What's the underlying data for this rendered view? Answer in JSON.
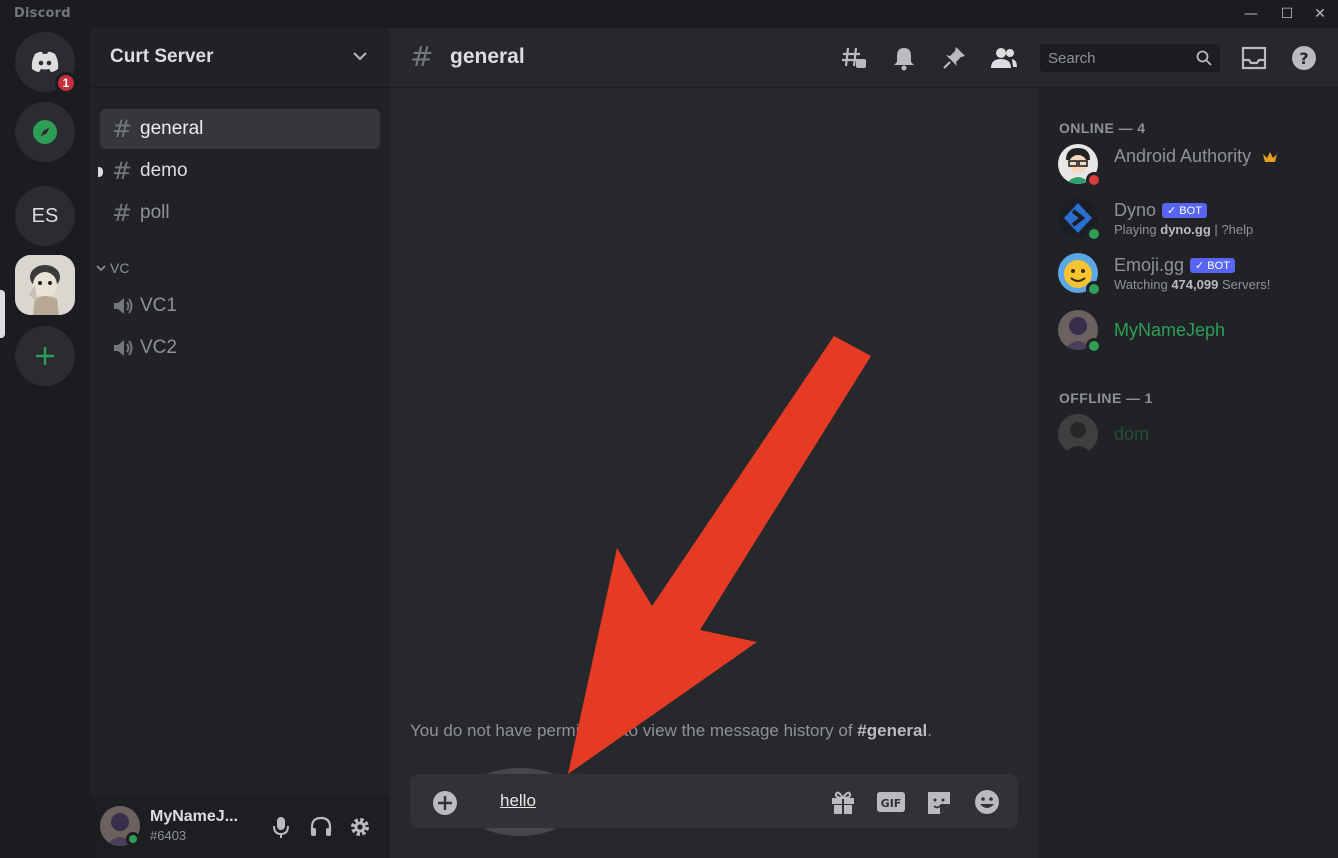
{
  "window": {
    "brand": "Discord",
    "minimize": "—",
    "maximize": "☐",
    "close": "✕"
  },
  "rail": {
    "home_badge": "1",
    "es_label": "ES"
  },
  "sidebar": {
    "server_name": "Curt Server",
    "channels": [
      {
        "name": "general",
        "state": "active"
      },
      {
        "name": "demo",
        "state": "unread"
      },
      {
        "name": "poll",
        "state": "normal"
      }
    ],
    "category": "VC",
    "voice_channels": [
      {
        "name": "VC1"
      },
      {
        "name": "VC2"
      }
    ],
    "user": {
      "name": "MyNameJ...",
      "tag": "#6403"
    }
  },
  "topbar": {
    "hash": "#",
    "channel_name": "general",
    "search_placeholder": "Search"
  },
  "chat": {
    "no_permission_prefix": "You do not have permission to view the message history of ",
    "no_permission_channel": "#general",
    "no_permission_suffix": ".",
    "input_value": "hello"
  },
  "members": {
    "online_header": "ONLINE — 4",
    "offline_header": "OFFLINE — 1",
    "online": [
      {
        "name": "Android Authority",
        "status": "dnd",
        "owner": true
      },
      {
        "name": "Dyno",
        "bot_tag": "✓ BOT",
        "activity_prefix": "Playing ",
        "activity_bold": "dyno.gg",
        "activity_rest": " | ?help"
      },
      {
        "name": "Emoji.gg",
        "bot_tag": "✓ BOT",
        "activity_prefix": "Watching ",
        "activity_bold": "474,099",
        "activity_rest": " Servers!"
      },
      {
        "name": "MyNameJeph"
      }
    ],
    "offline": [
      {
        "name": "dom"
      }
    ]
  },
  "colors": {
    "accent_green": "#2e9e57",
    "badge_red": "#c4303d",
    "bot_blurple": "#5865f2",
    "arrow_red": "#e53b25"
  }
}
